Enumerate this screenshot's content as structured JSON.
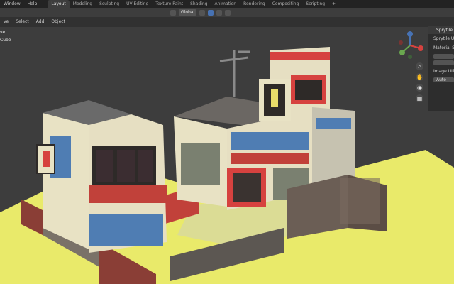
{
  "menu": {
    "window": "Window",
    "help": "Help"
  },
  "workspace_tabs": [
    "Layout",
    "Modeling",
    "Sculpting",
    "UV Editing",
    "Texture Paint",
    "Shading",
    "Animation",
    "Rendering",
    "Compositing",
    "Scripting"
  ],
  "active_tab": "Layout",
  "add_workspace": "+",
  "viewport_header": {
    "orientation": "Global"
  },
  "toolbar": {
    "items": [
      "ve",
      "Select",
      "Add",
      "Object"
    ]
  },
  "outliner": {
    "items": [
      "ve",
      "Cube"
    ]
  },
  "sidebar": {
    "panel_title": "Sprytile T",
    "row1": "Sprytile Util",
    "row2": "Material Se",
    "row3": "Image Utili",
    "auto_button": "Auto"
  },
  "gizmo": {
    "z_label": "Z",
    "x_label": "X",
    "y_label": "Y"
  },
  "colors": {
    "ground": "#e9ea6a",
    "bg": "#3d3d3d",
    "accent": "#4772b3",
    "building_blue": "#4f7db3",
    "building_red": "#d6423f",
    "building_cream": "#e8e2c4"
  }
}
